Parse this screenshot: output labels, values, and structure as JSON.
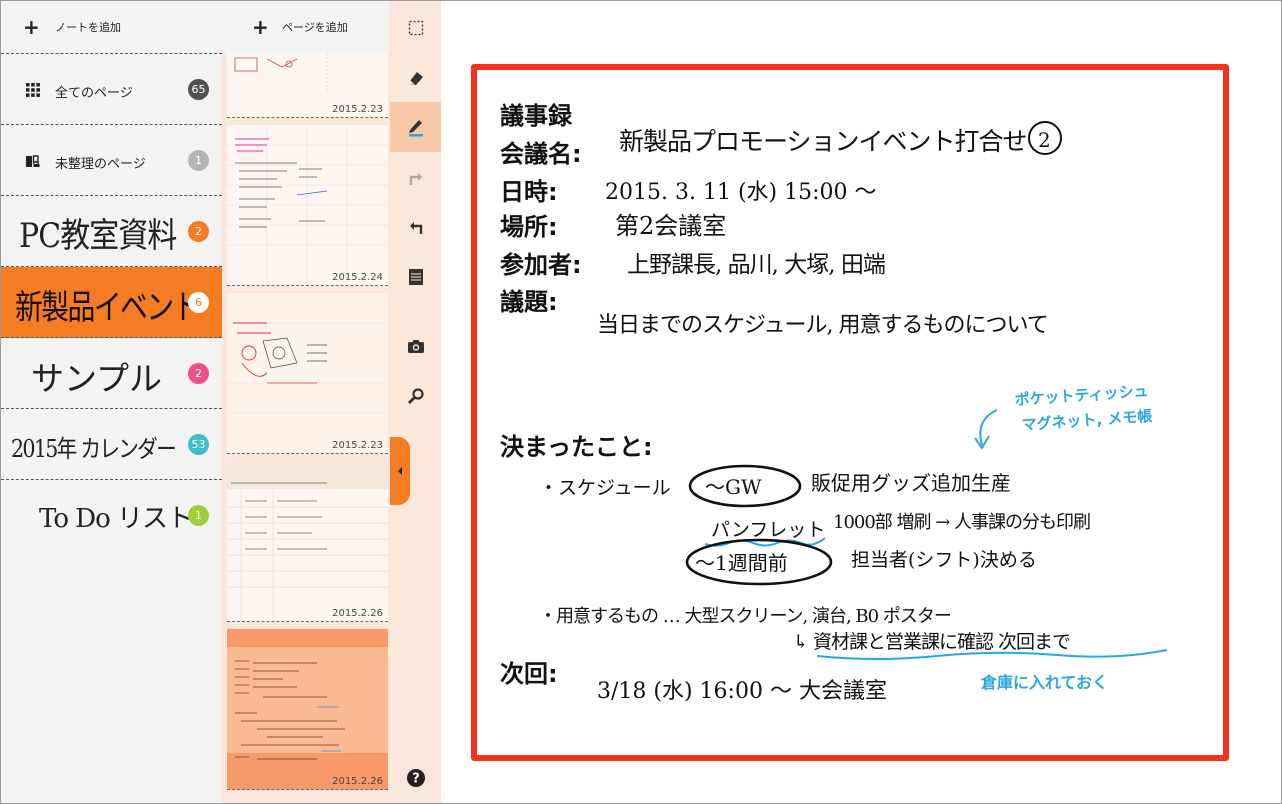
{
  "sidebar": {
    "add_note_label": "ノートを追加",
    "items": [
      {
        "label": "全てのページ",
        "count": "65",
        "badge_color": "#505050",
        "icon": "grid-icon"
      },
      {
        "label": "未整理のページ",
        "count": "1",
        "badge_color": "#b4b4b4",
        "icon": "unsorted-book-icon"
      },
      {
        "label": "PC教室資料",
        "count": "2",
        "badge_color": "#f57c22"
      },
      {
        "label": "新製品イベント",
        "count": "6",
        "badge_color": "#ffffff",
        "selected": true
      },
      {
        "label": "サンプル",
        "count": "2",
        "badge_color": "#ee4f8a"
      },
      {
        "label": "2015年 カレンダー",
        "count": "53",
        "badge_color": "#3fbec8"
      },
      {
        "label": "To Do リスト",
        "count": "1",
        "badge_color": "#9fce3a"
      }
    ]
  },
  "pages": {
    "add_page_label": "ページを追加",
    "thumbs": [
      {
        "date": "2015.2.23"
      },
      {
        "date": "2015.2.24"
      },
      {
        "date": "2015.2.23"
      },
      {
        "date": "2015.2.26"
      },
      {
        "date": "2015.2.26",
        "selected": true
      }
    ]
  },
  "tools": [
    {
      "icon": "lasso-select-icon"
    },
    {
      "icon": "eraser-icon"
    },
    {
      "icon": "pen-icon",
      "active": true
    },
    {
      "icon": "redo-icon"
    },
    {
      "icon": "undo-icon"
    },
    {
      "icon": "page-template-icon"
    },
    {
      "icon": "camera-icon"
    },
    {
      "icon": "zoom-icon"
    },
    {
      "icon": "help-icon"
    }
  ],
  "note": {
    "title": "議事録",
    "meeting_label": "会議名:",
    "meeting_value": "新製品プロモーションイベント打合せ",
    "meeting_number": "2",
    "date_label": "日時:",
    "date_value": "2015. 3. 11 (水) 15:00 〜",
    "place_label": "場所:",
    "place_value": "第2会議室",
    "attendees_label": "参加者:",
    "attendees_value": "上野課長, 品川, 大塚, 田端",
    "agenda_label": "議題:",
    "agenda_value": "当日までのスケジュール, 用意するものについて",
    "decided_label": "決まったこと:",
    "memo_blue_1": "ポケットティッシュ",
    "memo_blue_2": "マグネット, メモ帳",
    "schedule_item": "・スケジュール",
    "gw_circle": "〜GW",
    "gw_text": "販促用グッズ追加生産",
    "pamphlet": "パンフレット",
    "pamphlet_text": "1000部 増刷 → 人事課の分も印刷",
    "week_circle": "〜1週間前",
    "week_text": "担当者(シフト)決める",
    "prepare_item": "・用意するもの … 大型スクリーン, 演台, B0 ポスター",
    "confirm_text": "↳ 資材課と営業課に確認 次回まで",
    "warehouse": "倉庫に入れておく",
    "next_label": "次回:",
    "next_value": "3/18 (水)  16:00 〜  大会議室"
  },
  "colors": {
    "accent_orange": "#f57c22",
    "card_border": "#f5331d",
    "ink_blue": "#29a8e0",
    "ink_black": "#111111"
  }
}
